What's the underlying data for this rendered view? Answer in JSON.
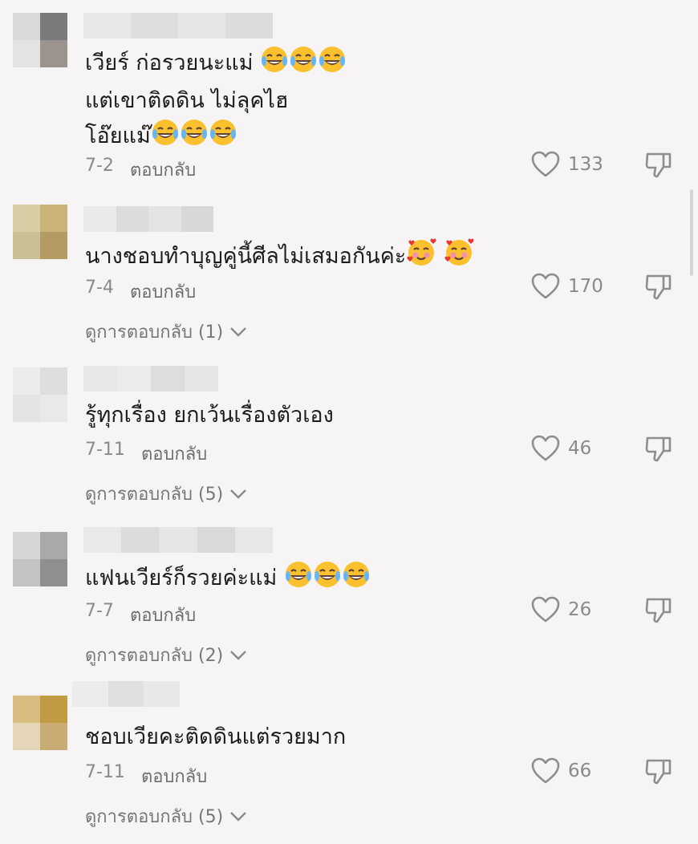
{
  "comments": [
    {
      "lines": [
        "เวียร์ ก่อรวยนะแม่",
        "แต่เขาติดดิน ไม่ลุคไฮ",
        "โอ๊ยแม๊"
      ],
      "emojis": [
        "laughing-tears",
        "laughing-tears",
        "laughing-tears"
      ],
      "date": "7-2",
      "reply_label": "ตอบกลับ",
      "likes": "133"
    },
    {
      "lines": [
        "นางชอบทำบุญคู่นี้ศีลไม่เสมอกันค่ะ"
      ],
      "emojis": [
        "smiling-hearts",
        "smiling-hearts"
      ],
      "date": "7-4",
      "reply_label": "ตอบกลับ",
      "likes": "170",
      "view_replies": "ดูการตอบกลับ (1)"
    },
    {
      "lines": [
        "รู้ทุกเรื่อง ยกเว้นเรื่องตัวเอง"
      ],
      "emojis": [],
      "date": "7-11",
      "reply_label": "ตอบกลับ",
      "likes": "46",
      "view_replies": "ดูการตอบกลับ (5)"
    },
    {
      "lines": [
        "แฟนเวียร์ก็รวยค่ะแม่"
      ],
      "emojis": [
        "laughing-tears",
        "laughing-tears",
        "laughing-tears"
      ],
      "date": "7-7",
      "reply_label": "ตอบกลับ",
      "likes": "26",
      "view_replies": "ดูการตอบกลับ (2)"
    },
    {
      "lines": [
        "ชอบเวียคะติดดินแต่รวยมาก"
      ],
      "emojis": [],
      "date": "7-11",
      "reply_label": "ตอบกลับ",
      "likes": "66",
      "view_replies": "ดูการตอบกลับ (5)"
    }
  ],
  "colors": {
    "background": "#f6f4f5",
    "meta_text": "#8a8a8a",
    "icon_stroke": "#8e8e8e"
  }
}
